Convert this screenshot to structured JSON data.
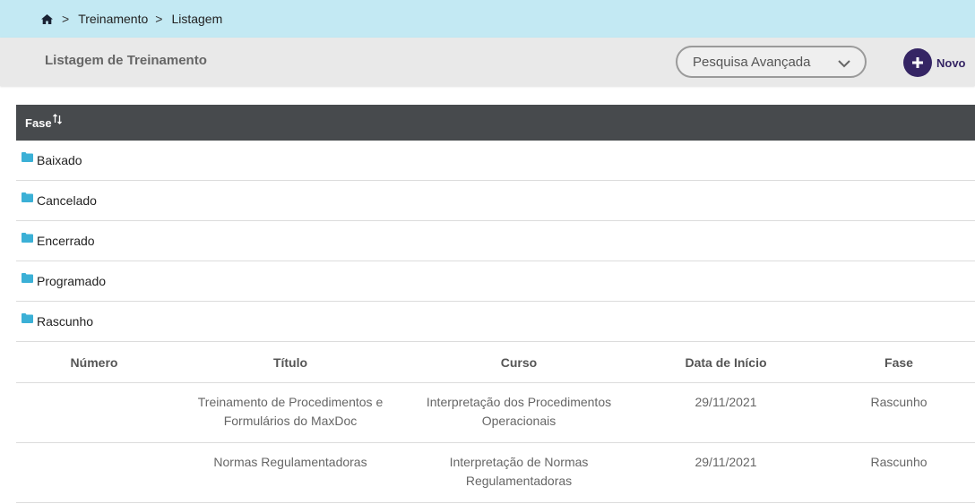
{
  "breadcrumb": {
    "items": [
      "Treinamento",
      "Listagem"
    ],
    "separator": ">"
  },
  "header": {
    "title": "Listagem de Treinamento",
    "advanced_search": "Pesquisa Avançada",
    "new_label": "Novo"
  },
  "grid": {
    "group_column": "Fase",
    "groups": [
      "Baixado",
      "Cancelado",
      "Encerrado",
      "Programado",
      "Rascunho"
    ],
    "columns": [
      "Número",
      "Título",
      "Curso",
      "Data de Início",
      "Fase"
    ],
    "rows": [
      {
        "numero": "",
        "titulo": "Treinamento de Procedimentos e Formulários do MaxDoc",
        "curso": "Interpretação dos Procedimentos Operacionais",
        "data": "29/11/2021",
        "fase": "Rascunho"
      },
      {
        "numero": "",
        "titulo": "Normas Regulamentadoras",
        "curso": "Interpretação de Normas Regulamentadoras",
        "data": "29/11/2021",
        "fase": "Rascunho"
      }
    ]
  },
  "colors": {
    "accent": "#352564",
    "breadcrumb_bg": "#c3e9f3",
    "grid_header_bg": "#474a4d",
    "folder": "#3bb0d6"
  },
  "icons": {
    "home": "home-icon",
    "folder": "folder-icon",
    "sort": "sort-icon",
    "chevron": "chevron-down-icon",
    "plus": "plus-icon"
  }
}
